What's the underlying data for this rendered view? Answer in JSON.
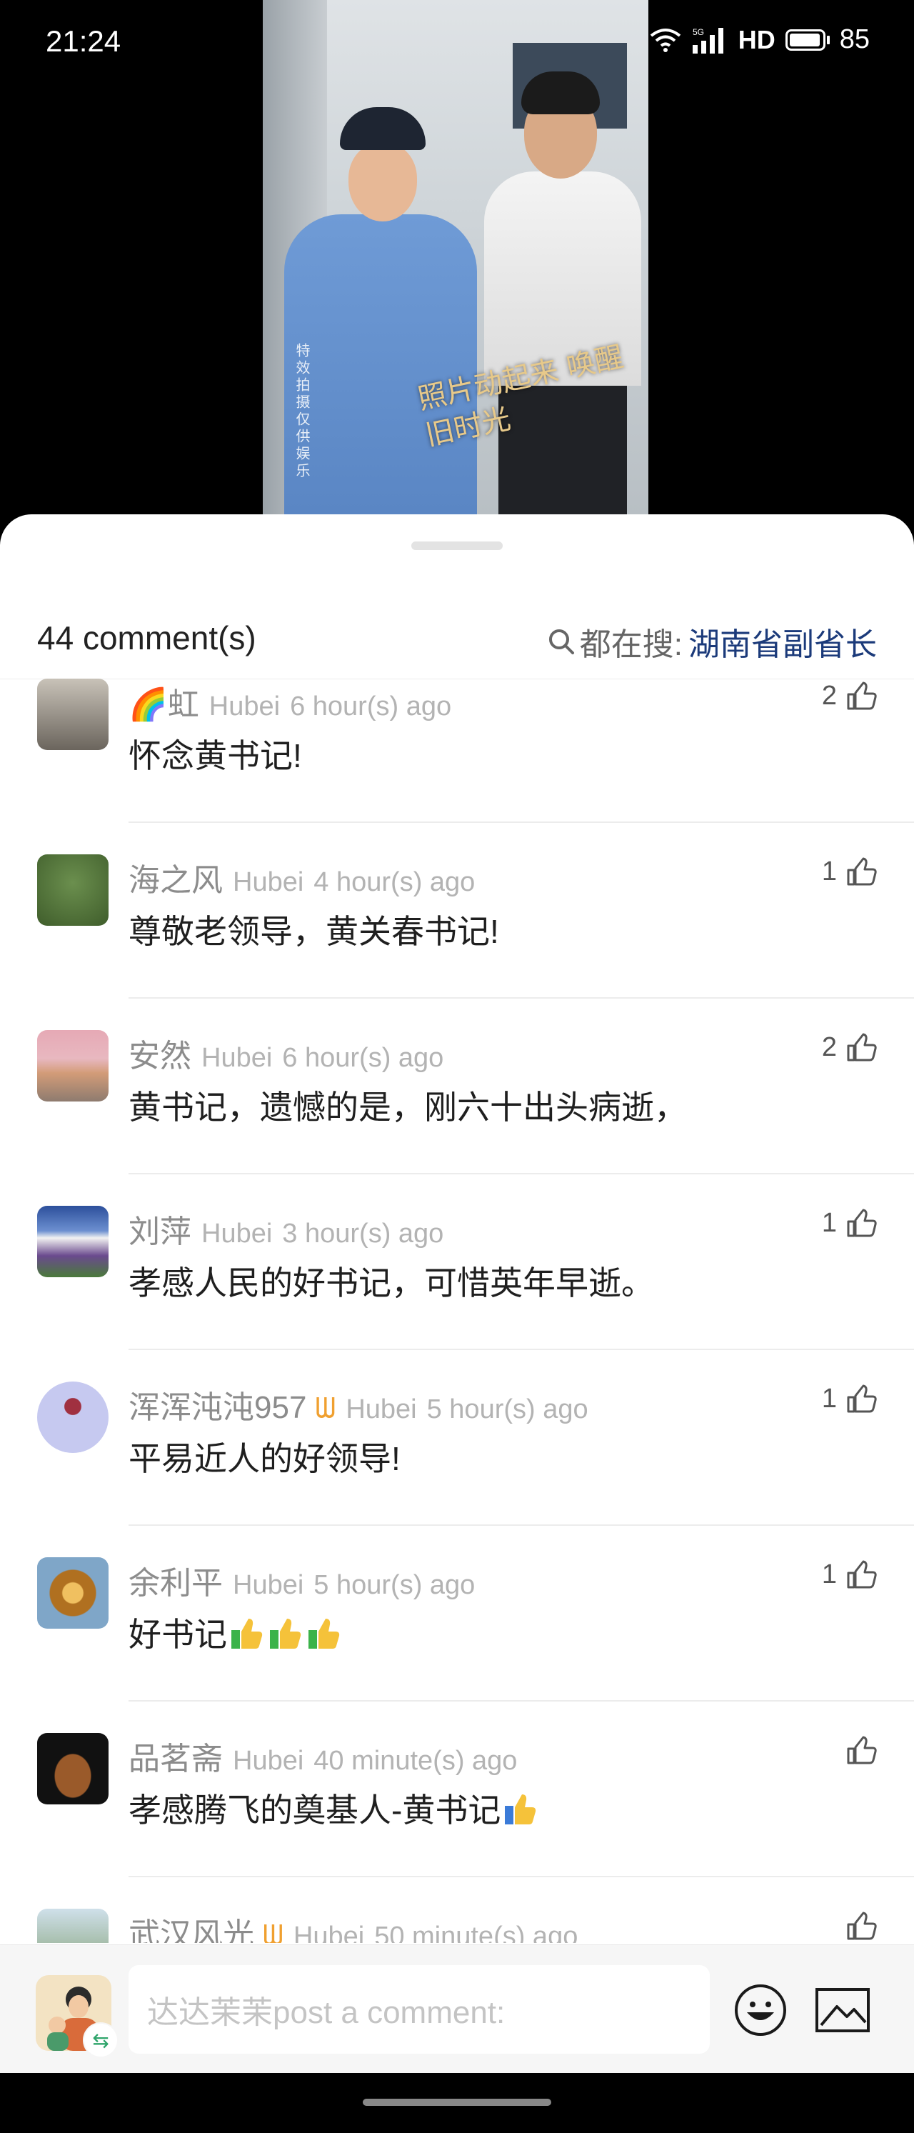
{
  "status_bar": {
    "time": "21:24",
    "network": "5G",
    "hd": "HD",
    "battery": "85"
  },
  "video": {
    "vertical_caption": "特效拍摄仅供娱乐",
    "overlay_text": "照片动起来 唤醒旧时光"
  },
  "header": {
    "comment_count": "44 comment(s)",
    "hot_search_label": "都在搜:",
    "hot_search_term": "湖南省副省长"
  },
  "comments": [
    {
      "name": "🌈虹",
      "vip": "",
      "location": "Hubei",
      "time": "6 hour(s) ago",
      "text": "怀念黄书记!",
      "likes": "2"
    },
    {
      "name": "海之风",
      "vip": "",
      "location": "Hubei",
      "time": "4 hour(s) ago",
      "text": "尊敬老领导，黄关春书记!",
      "likes": "1"
    },
    {
      "name": "安然",
      "vip": "",
      "location": "Hubei",
      "time": "6 hour(s) ago",
      "text": "黄书记，遗憾的是，刚六十出头病逝，",
      "likes": "2"
    },
    {
      "name": "刘萍",
      "vip": "",
      "location": "Hubei",
      "time": "3 hour(s) ago",
      "text": "孝感人民的好书记，可惜英年早逝。",
      "likes": "1"
    },
    {
      "name": "浑浑沌沌957",
      "vip": "ᗯ",
      "location": "Hubei",
      "time": "5 hour(s) ago",
      "text": "平易近人的好领导!",
      "likes": "1"
    },
    {
      "name": "余利平",
      "vip": "",
      "location": "Hubei",
      "time": "5 hour(s) ago",
      "text": "好书记",
      "likes": "1"
    },
    {
      "name": "品茗斋",
      "vip": "",
      "location": "Hubei",
      "time": "40 minute(s) ago",
      "text": "孝感腾飞的奠基人-黄书记",
      "likes": ""
    },
    {
      "name": "武汉风光",
      "vip": "ᗯ",
      "location": "Hubei",
      "time": "50 minute(s) ago",
      "text": "",
      "likes": ""
    }
  ],
  "input_bar": {
    "placeholder": "达达茉茉post a comment:",
    "swap_icon": "⇆"
  },
  "colors": {
    "accent_link": "#1b3a7a",
    "meta_gray": "#b3b3b3",
    "vip_gold": "#f0a030"
  },
  "icons": [
    "wifi-icon",
    "signal-icon",
    "battery-icon",
    "search-icon",
    "thumbs-up-icon",
    "emoji-icon",
    "image-icon"
  ]
}
